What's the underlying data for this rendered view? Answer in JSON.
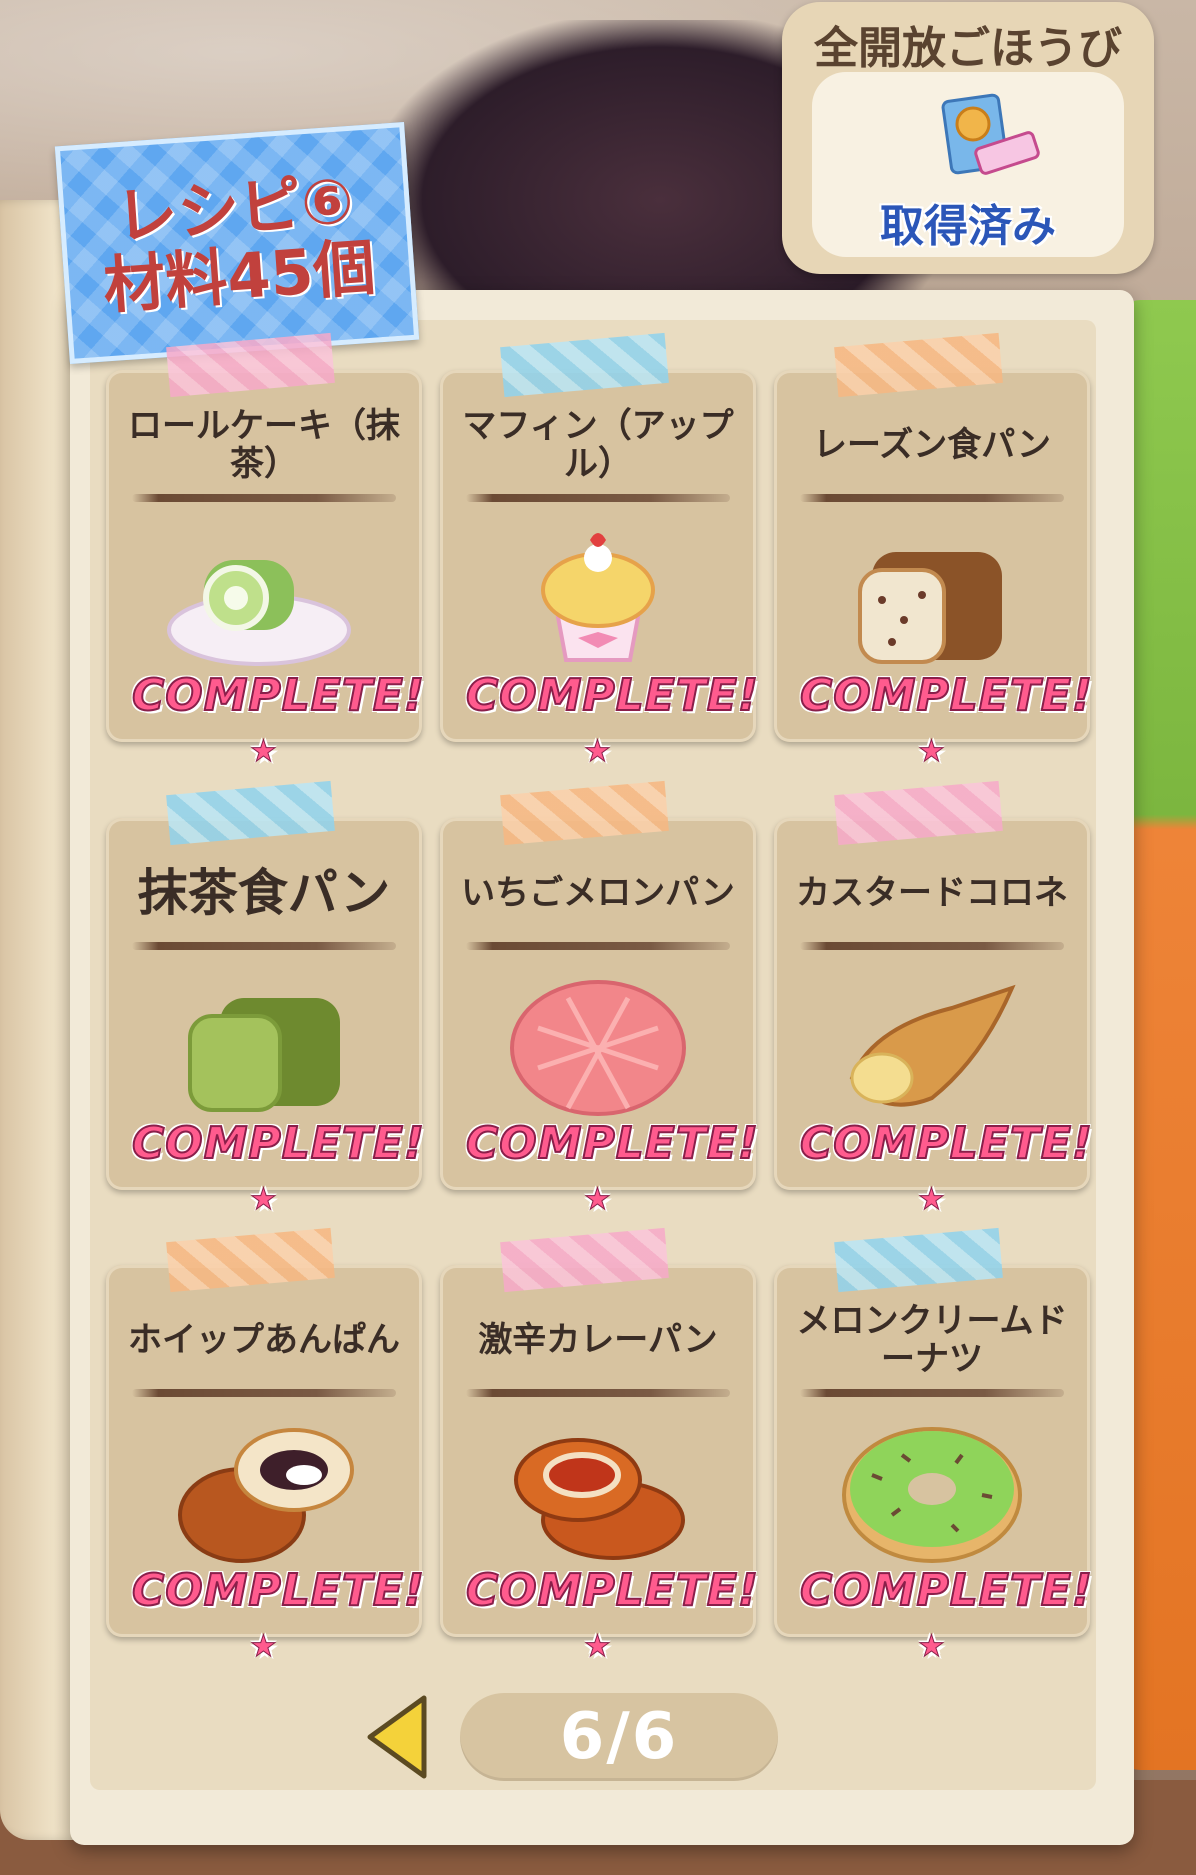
{
  "recipe_tag": {
    "line1": "レシピ⑥",
    "line2": "材料45個"
  },
  "reward": {
    "title": "全開放ごほうび",
    "status": "取得済み"
  },
  "complete_label": "COMPLETE!",
  "recipes": [
    {
      "name": "ロールケーキ（抹茶）",
      "tape": "pink"
    },
    {
      "name": "マフィン（アップル）",
      "tape": "blue"
    },
    {
      "name": "レーズン食パン",
      "tape": "orange"
    },
    {
      "name": "抹茶食パン",
      "tape": "blue"
    },
    {
      "name": "いちごメロンパン",
      "tape": "orange"
    },
    {
      "name": "カスタードコロネ",
      "tape": "pink"
    },
    {
      "name": "ホイップあんぱん",
      "tape": "orange"
    },
    {
      "name": "激辛カレーパン",
      "tape": "pink"
    },
    {
      "name": "メロンクリームドーナツ",
      "tape": "blue"
    }
  ],
  "pagination": {
    "label": "6/6",
    "current": 6,
    "total": 6
  },
  "colors": {
    "accent_pink": "#ff5b8e",
    "panel": "#d7c3a0",
    "page": "#f2ead8",
    "tag_blue": "#5fa7f0"
  }
}
